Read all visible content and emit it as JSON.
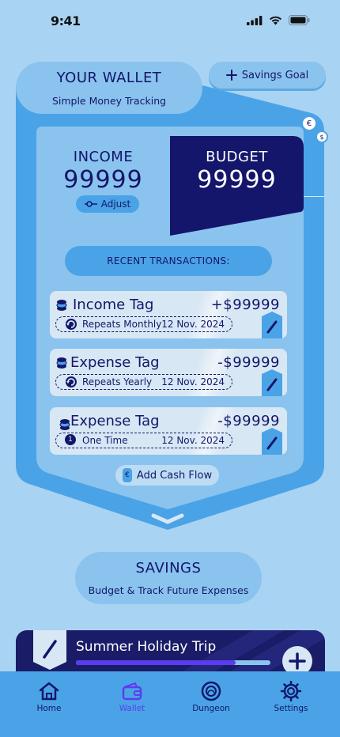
{
  "status": {
    "time": "9:41"
  },
  "wallet": {
    "title": "YOUR WALLET",
    "subtitle": "Simple Money Tracking"
  },
  "savings_goal_button": {
    "label": "Savings Goal"
  },
  "income": {
    "label": "INCOME",
    "value": "99999",
    "adjust_label": "Adjust"
  },
  "budget": {
    "label": "BUDGET",
    "value": "99999"
  },
  "recent": {
    "label": "RECENT TRANSACTIONS:"
  },
  "transactions": [
    {
      "title": "Income Tag",
      "amount": "+$99999",
      "repeat": "Repeats Monthly",
      "date": "12 Nov. 2024",
      "repeat_icon": "repeat-icon"
    },
    {
      "title": "Expense Tag",
      "amount": "-$99999",
      "repeat": "Repeats Yearly",
      "date": "12 Nov. 2024",
      "repeat_icon": "repeat-icon"
    },
    {
      "title": "Expense Tag",
      "amount": "-$99999",
      "repeat": "One Time",
      "date": "12 Nov. 2024",
      "repeat_icon": "one-time-icon",
      "repeat_icon_text": "1"
    }
  ],
  "add_cash_flow": {
    "label": "Add Cash Flow",
    "icon_text": "€"
  },
  "savings": {
    "title": "SAVINGS",
    "subtitle": "Budget & Track Future Expenses"
  },
  "trip": {
    "title": "Summer Holiday Trip",
    "progress": 0.82
  },
  "nav": [
    {
      "label": "Home",
      "active": false
    },
    {
      "label": "Wallet",
      "active": true
    },
    {
      "label": "Dungeon",
      "active": false
    },
    {
      "label": "Settings",
      "active": false
    }
  ],
  "colors": {
    "background": "#a9d3f3",
    "shield": "#4aa3e6",
    "navy": "#13166a",
    "accent_purple": "#5b3df0",
    "card_light": "#d8e7f4"
  },
  "coin_symbols": {
    "euro": "€",
    "dollar": "$"
  }
}
